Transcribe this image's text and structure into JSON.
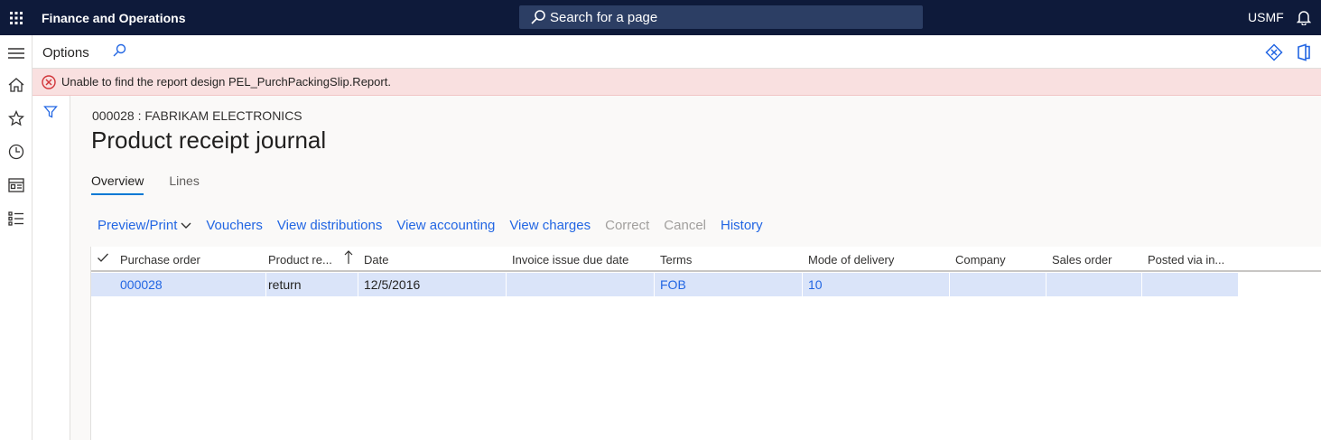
{
  "topbar": {
    "app_title": "Finance and Operations",
    "search_placeholder": "Search for a page",
    "company": "USMF"
  },
  "actionbar": {
    "options_label": "Options"
  },
  "error": {
    "message": "Unable to find the report design PEL_PurchPackingSlip.Report."
  },
  "page": {
    "caption": "000028 : FABRIKAM ELECTRONICS",
    "title": "Product receipt journal"
  },
  "tabs": [
    {
      "label": "Overview",
      "active": true
    },
    {
      "label": "Lines",
      "active": false
    }
  ],
  "toolbar": {
    "preview_print": "Preview/Print",
    "vouchers": "Vouchers",
    "view_distributions": "View distributions",
    "view_accounting": "View accounting",
    "view_charges": "View charges",
    "correct": "Correct",
    "cancel": "Cancel",
    "history": "History"
  },
  "grid": {
    "columns": [
      "Purchase order",
      "Product re...",
      "Date",
      "Invoice issue due date",
      "Terms",
      "Mode of delivery",
      "Company",
      "Sales order",
      "Posted via in..."
    ],
    "rows": [
      {
        "purchase_order": "000028",
        "product_receipt": "return",
        "date": "12/5/2016",
        "invoice_issue_due_date": "",
        "terms": "FOB",
        "mode_of_delivery": "10",
        "company": "",
        "sales_order": "",
        "posted_via": ""
      }
    ]
  },
  "colors": {
    "topbar": "#0e1a3a",
    "link": "#2266e3",
    "error_bg": "#f9e0e0",
    "error_icon": "#d13438",
    "selected_row": "#dae4f9"
  }
}
